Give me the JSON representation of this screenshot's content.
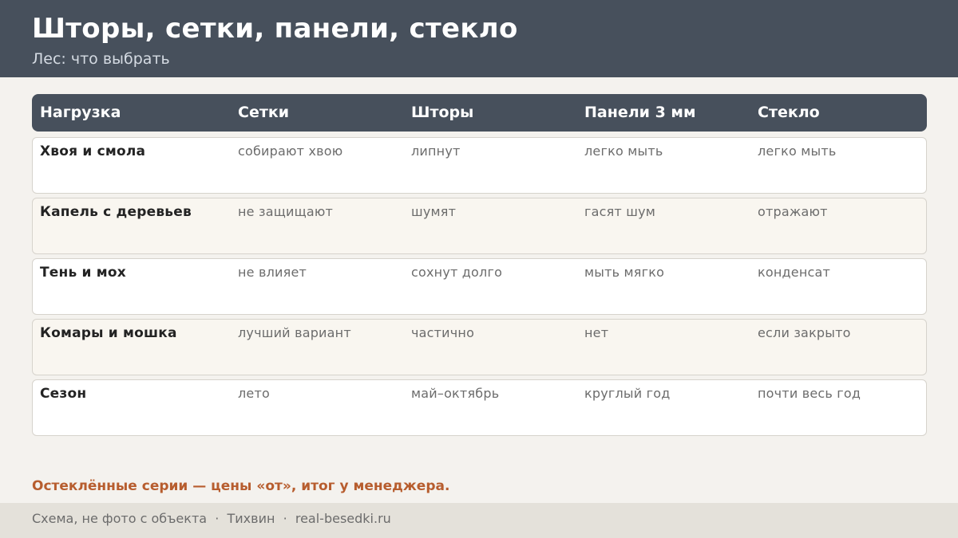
{
  "header": {
    "title": "Шторы, сетки, панели, стекло",
    "subtitle": "Лес: что выбрать"
  },
  "table": {
    "columns": [
      "Нагрузка",
      "Сетки",
      "Шторы",
      "Панели 3 мм",
      "Стекло"
    ],
    "rows": [
      [
        "Хвоя и смола",
        "собирают хвою",
        "липнут",
        "легко мыть",
        "легко мыть"
      ],
      [
        "Капель с деревьев",
        "не защищают",
        "шумят",
        "гасят шум",
        "отражают"
      ],
      [
        "Тень и мох",
        "не влияет",
        "сохнут долго",
        "мыть мягко",
        "конденсат"
      ],
      [
        "Комары и мошка",
        "лучший вариант",
        "частично",
        "нет",
        "если закрыто"
      ],
      [
        "Сезон",
        "лето",
        "май–октябрь",
        "круглый год",
        "почти весь год"
      ]
    ]
  },
  "note": "Остеклённые серии — цены «от», итог у менеджера.",
  "footer": {
    "text": "Схема, не фото с объекта  ·  Тихвин  ·  real-besedki.ru"
  },
  "colors": {
    "header_bg": "#47505c",
    "accent": "#b75d2e",
    "page_bg": "#f4f2ee"
  }
}
